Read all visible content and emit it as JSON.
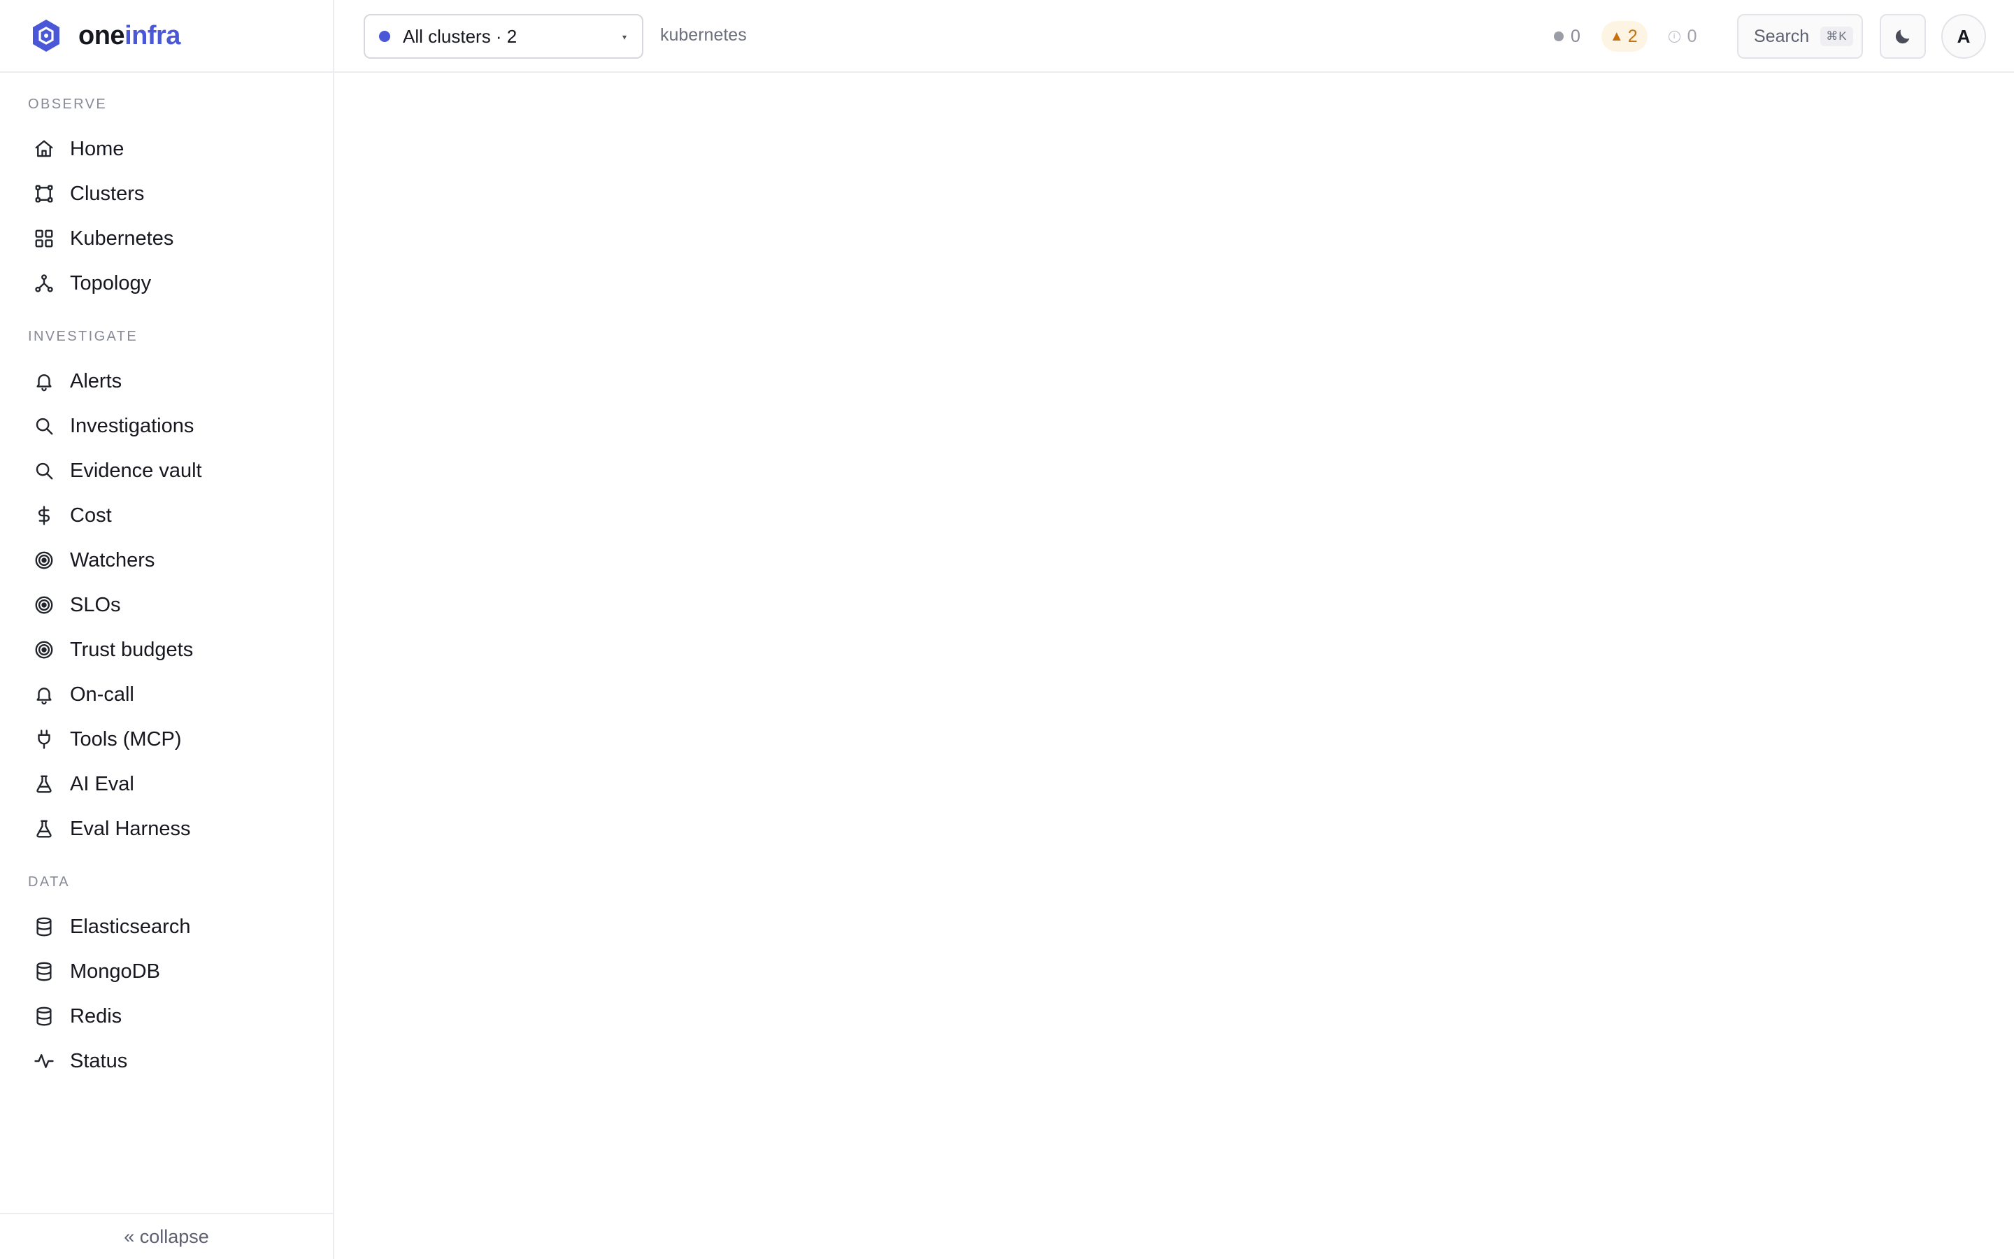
{
  "brand": {
    "name_primary": "one",
    "name_accent": "infra",
    "accent_color": "#4a57d6"
  },
  "sidebar": {
    "sections": [
      {
        "title": "OBSERVE",
        "items": [
          {
            "label": "Home",
            "icon": "home-icon"
          },
          {
            "label": "Clusters",
            "icon": "clusters-icon"
          },
          {
            "label": "Kubernetes",
            "icon": "grid-icon"
          },
          {
            "label": "Topology",
            "icon": "topology-icon"
          }
        ]
      },
      {
        "title": "INVESTIGATE",
        "items": [
          {
            "label": "Alerts",
            "icon": "bell-icon"
          },
          {
            "label": "Investigations",
            "icon": "search-icon"
          },
          {
            "label": "Evidence vault",
            "icon": "search-icon"
          },
          {
            "label": "Cost",
            "icon": "dollar-icon"
          },
          {
            "label": "Watchers",
            "icon": "target-icon"
          },
          {
            "label": "SLOs",
            "icon": "target-icon"
          },
          {
            "label": "Trust budgets",
            "icon": "target-icon"
          },
          {
            "label": "On-call",
            "icon": "bell-icon"
          },
          {
            "label": "Tools (MCP)",
            "icon": "plug-icon"
          },
          {
            "label": "AI Eval",
            "icon": "flask-icon"
          },
          {
            "label": "Eval Harness",
            "icon": "flask-icon"
          }
        ]
      },
      {
        "title": "DATA",
        "items": [
          {
            "label": "Elasticsearch",
            "icon": "database-icon"
          },
          {
            "label": "MongoDB",
            "icon": "database-icon"
          },
          {
            "label": "Redis",
            "icon": "database-icon"
          },
          {
            "label": "Status",
            "icon": "activity-icon"
          }
        ]
      }
    ],
    "collapse_label": "« collapse"
  },
  "topbar": {
    "cluster_selector": "All clusters · 2",
    "breadcrumb": "kubernetes",
    "counts": {
      "grey": "0",
      "warning": "2",
      "info": "0"
    },
    "search_label": "Search",
    "search_shortcut": "⌘K",
    "avatar_initial": "A"
  }
}
